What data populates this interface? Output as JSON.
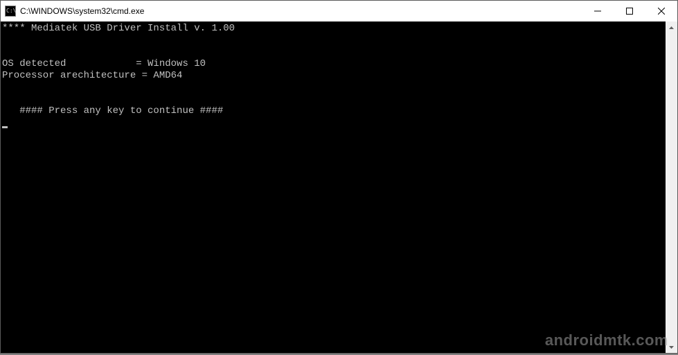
{
  "window": {
    "title": "C:\\WINDOWS\\system32\\cmd.exe"
  },
  "terminal": {
    "line1": "**** Mediatek USB Driver Install v. 1.00",
    "line2": "",
    "line3": "",
    "line4": "OS detected            = Windows 10",
    "line5": "Processor arechitecture = AMD64",
    "line6": "",
    "line7": "",
    "line8": "   #### Press any key to continue ####"
  },
  "watermark": "androidmtk.com"
}
